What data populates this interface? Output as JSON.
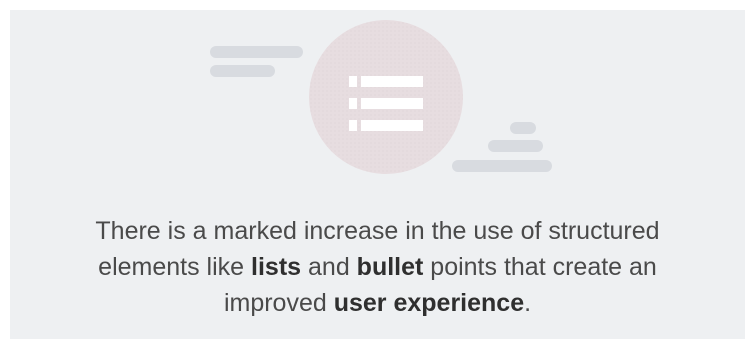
{
  "illustration": {
    "icon": "list-icon",
    "circle_color": "#e7dde0",
    "cloud_color": "#d8dbe0",
    "icon_color": "#ffffff"
  },
  "caption": {
    "line1": "There is a marked increase in the use of structured",
    "line2_pre": "elements like ",
    "lists": "lists",
    "line2_mid": " and ",
    "bullet": "bullet",
    "line2_post": " points that create an",
    "line3_pre": "improved ",
    "user_experience": "user experience",
    "line3_post": "."
  }
}
